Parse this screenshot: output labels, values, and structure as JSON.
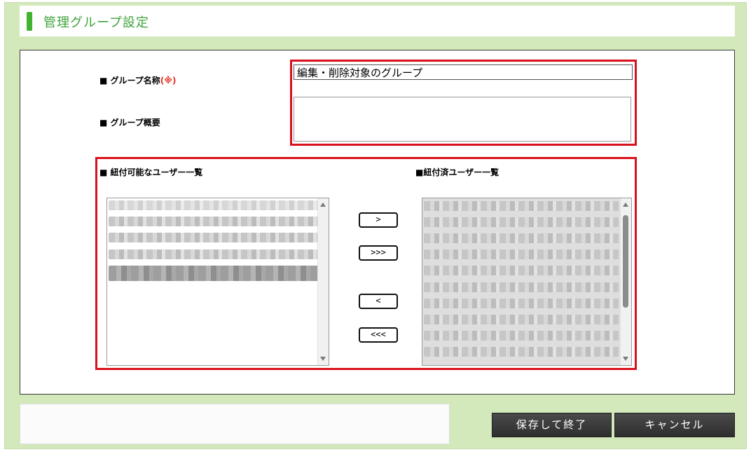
{
  "header": {
    "title": "管理グループ設定"
  },
  "form": {
    "group_name_label": "■ グループ名称",
    "required_mark": "(※)",
    "group_name_value": "編集・削除対象のグループ",
    "group_desc_label": "■ グループ概要",
    "group_desc_value": ""
  },
  "assign": {
    "available_label": "■ 紐付可能なユーザー一覧",
    "assigned_label": "■紐付済ユーザー一覧",
    "buttons": {
      "add_one": ">",
      "add_all": ">>>",
      "remove_one": "<",
      "remove_all": "<<<"
    }
  },
  "footer": {
    "save_label": "保存して終了",
    "cancel_label": "キャンセル"
  },
  "colors": {
    "accent_green": "#41b331",
    "frame_green": "#d3e9bb",
    "highlight_red": "#d9111b",
    "required_red": "#e0301e"
  }
}
